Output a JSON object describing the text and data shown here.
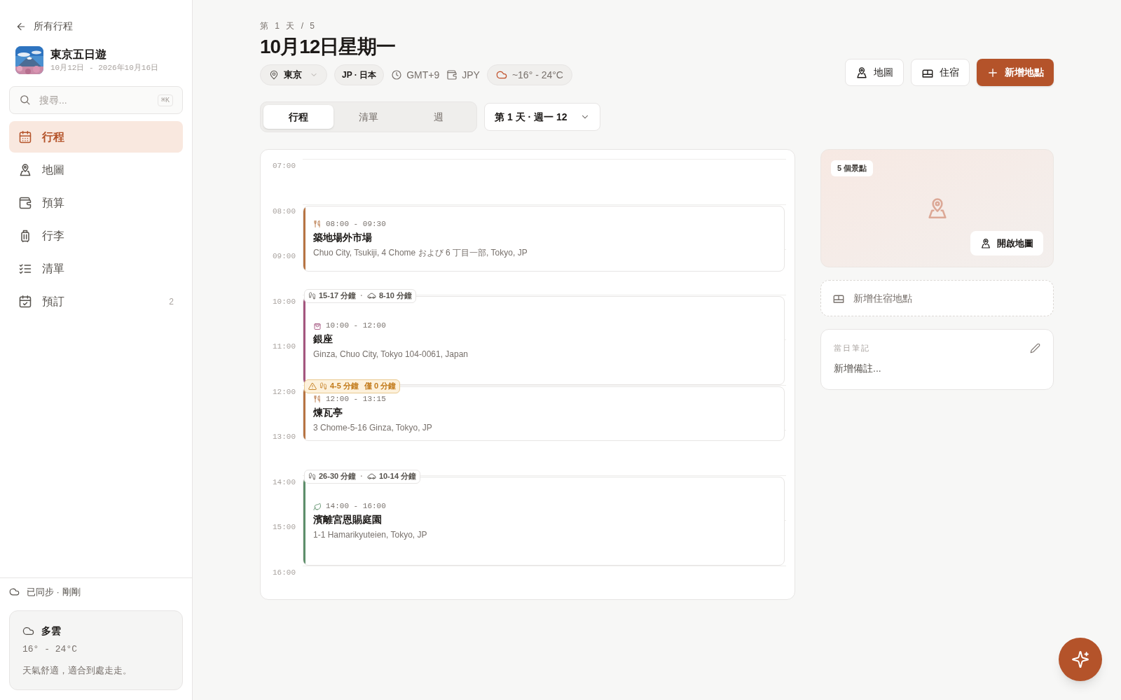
{
  "sidebar": {
    "back_link": "所有行程",
    "trip": {
      "title": "東京五日遊",
      "dates": "10月12日 - 2026年10月16日"
    },
    "search": {
      "placeholder": "搜尋...",
      "shortcut": "⌘K"
    },
    "nav": [
      {
        "kind": "itinerary",
        "label": "行程",
        "selected": true
      },
      {
        "kind": "map",
        "label": "地圖",
        "selected": false
      },
      {
        "kind": "budget",
        "label": "預算",
        "selected": false
      },
      {
        "kind": "luggage",
        "label": "行李",
        "selected": false
      },
      {
        "kind": "checklist",
        "label": "清單",
        "selected": false
      },
      {
        "kind": "bookings",
        "label": "預訂",
        "selected": false,
        "count": "2"
      }
    ],
    "sync_status": "已同步 · 剛剛",
    "weather": {
      "condition": "多雲",
      "temps": "16° - 24°C",
      "note": "天氣舒適，適合到處走走。"
    }
  },
  "header": {
    "day_counter": "第 1 天 / 5",
    "title": "10月12日星期一",
    "location": "東京",
    "country": "JP · 日本",
    "timezone": "GMT+9",
    "currency": "JPY",
    "weather": "~16° - 24°C",
    "actions": [
      {
        "kind": "map",
        "label": "地圖"
      },
      {
        "kind": "lodging",
        "label": "住宿"
      },
      {
        "kind": "add",
        "label": "新增地點"
      }
    ]
  },
  "view_tabs": [
    {
      "label": "行程",
      "selected": true
    },
    {
      "label": "清單",
      "selected": false
    },
    {
      "label": "週",
      "selected": false
    }
  ],
  "day_select": "第 1 天 · 週一 12",
  "timeline": {
    "hours": [
      "07:00",
      "08:00",
      "09:00",
      "10:00",
      "11:00",
      "12:00",
      "13:00",
      "14:00",
      "15:00",
      "16:00"
    ],
    "events": [
      {
        "kind": "food",
        "color": "#b77443",
        "time": "08:00 - 09:30",
        "name": "築地場外市場",
        "address": "Chuo City, Tsukiji, 4 Chome および 6 丁目一部, Tokyo, JP"
      },
      {
        "kind": "shopping",
        "color": "#a4567f",
        "time": "10:00 - 12:00",
        "name": "銀座",
        "address": "Ginza, Chuo City, Tokyo 104-0061, Japan",
        "travel": {
          "warning": false,
          "walk": "15-17 分鐘",
          "separator": "·",
          "drive": "8-10 分鐘"
        }
      },
      {
        "kind": "food",
        "color": "#b77443",
        "time": "12:00 - 13:15",
        "name": "煉瓦亭",
        "address": "3 Chome-5-16 Ginza, Tokyo, JP",
        "travel": {
          "warning": true,
          "walk": "4-5 分鐘",
          "gap": "僅 0 分鐘"
        }
      },
      {
        "kind": "nature",
        "color": "#5e8f6b",
        "time": "14:00 - 16:00",
        "name": "濱離宮恩賜庭園",
        "address": "1-1 Hamarikyuteien, Tokyo, JP",
        "travel": {
          "warning": false,
          "walk": "26-30 分鐘",
          "separator": "·",
          "drive": "10-14 分鐘"
        }
      }
    ]
  },
  "map_card": {
    "count": "5 個景點",
    "button": "開啟地圖"
  },
  "add_lodging": "新增住宿地點",
  "notes": {
    "label": "當日筆記",
    "placeholder": "新增備註..."
  }
}
